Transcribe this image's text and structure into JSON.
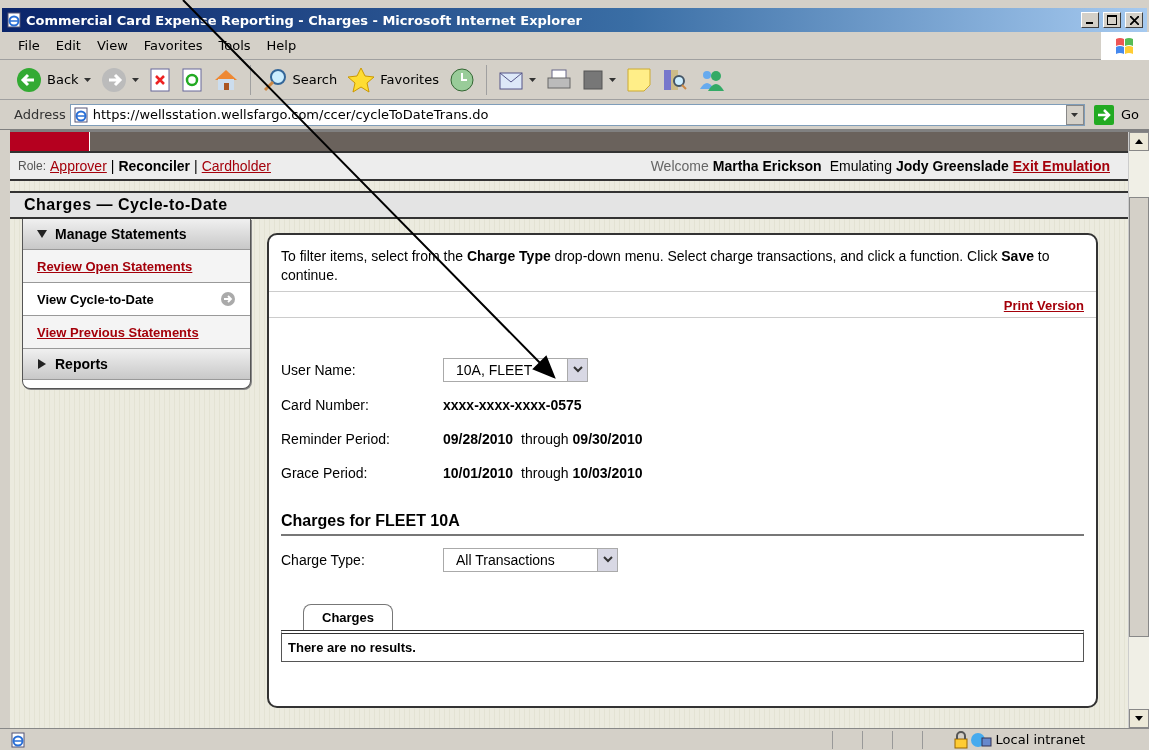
{
  "window": {
    "title": "Commercial Card Expense Reporting - Charges - Microsoft Internet Explorer"
  },
  "menu": [
    "File",
    "Edit",
    "View",
    "Favorites",
    "Tools",
    "Help"
  ],
  "toolbar": {
    "back": "Back",
    "search": "Search",
    "favorites": "Favorites"
  },
  "address": {
    "label": "Address",
    "url": "https://wellsstation.wellsfargo.com/ccer/cycleToDateTrans.do",
    "go": "Go"
  },
  "roles": {
    "label": "Role:",
    "items": [
      {
        "label": "Approver",
        "selected": false
      },
      {
        "label": "Reconciler",
        "selected": true
      },
      {
        "label": "Cardholder",
        "selected": false
      }
    ],
    "separators": [
      "|",
      "|"
    ]
  },
  "welcome": {
    "greeting": "Welcome",
    "user": "Martha Erickson",
    "emulating": "Emulating",
    "emulated_user": "Jody Greenslade",
    "exit": "Exit Emulation"
  },
  "page_title": "Charges — Cycle-to-Date",
  "sidebar": [
    {
      "label": "Manage Statements",
      "expanded": true,
      "children": [
        {
          "label": "Review Open Statements",
          "selected": false
        },
        {
          "label": "View Cycle-to-Date",
          "selected": true
        },
        {
          "label": "View Previous Statements",
          "selected": false
        }
      ]
    },
    {
      "label": "Reports",
      "expanded": false
    }
  ],
  "instructions": "To filter items, select from the **Charge Type** drop-down menu. Select charge transactions, and click a function. Click **Save** to continue.",
  "print_link": "Print Version",
  "fields": [
    {
      "kind": "select",
      "label": "User Name:",
      "value": "10A, FLEET"
    },
    {
      "kind": "text",
      "label": "Card Number:",
      "value": "xxxx-xxxx-xxxx-0575"
    },
    {
      "kind": "range",
      "label": "Reminder Period:",
      "from": "09/28/2010",
      "joiner": "through",
      "to": "09/30/2010"
    },
    {
      "kind": "range",
      "label": "Grace Period:",
      "from": "10/01/2010",
      "joiner": "through",
      "to": "10/03/2010"
    }
  ],
  "charges": {
    "heading": "Charges for FLEET 10A",
    "charge_type": {
      "label": "Charge Type:",
      "value": "All Transactions"
    },
    "tabs": [
      {
        "label": "Charges",
        "selected": true
      }
    ],
    "empty_message": "There are no results."
  },
  "status_bar": {
    "zone": "Local intranet"
  }
}
